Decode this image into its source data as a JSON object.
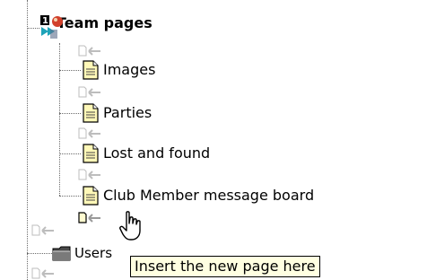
{
  "tree": {
    "root": {
      "label": "Team pages",
      "badge": "1"
    },
    "pages": [
      {
        "label": "Images"
      },
      {
        "label": "Parties"
      },
      {
        "label": "Lost and found"
      },
      {
        "label": "Club Member message board"
      }
    ],
    "sibling": {
      "label": "Users"
    }
  },
  "tooltip": {
    "text": "Insert the new page here"
  }
}
